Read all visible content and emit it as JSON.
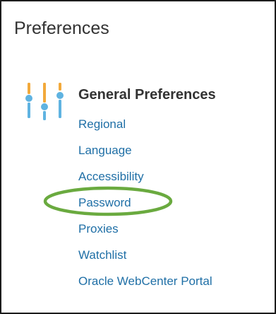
{
  "page": {
    "title": "Preferences"
  },
  "section": {
    "title": "General Preferences",
    "icon": "preferences-sliders-icon",
    "links": [
      {
        "label": "Regional"
      },
      {
        "label": "Language"
      },
      {
        "label": "Accessibility"
      },
      {
        "label": "Password"
      },
      {
        "label": "Proxies"
      },
      {
        "label": "Watchlist"
      },
      {
        "label": "Oracle WebCenter Portal"
      }
    ]
  },
  "annotation": {
    "highlighted_link": "Password",
    "ring_color": "#6aaa3f"
  },
  "colors": {
    "link": "#1f6fa6",
    "icon_orange": "#f2a93b",
    "icon_blue": "#5fb3e1",
    "text": "#333333"
  }
}
